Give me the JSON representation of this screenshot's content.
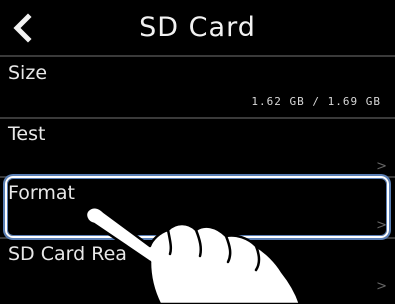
{
  "header": {
    "title": "SD Card",
    "back_icon": "chevron-left-icon"
  },
  "rows": [
    {
      "label": "Size",
      "value": "1.62 GB / 1.69 GB"
    },
    {
      "label": "Test",
      "chevron": ">"
    },
    {
      "label": "Format",
      "chevron": ">"
    },
    {
      "label": "SD Card Rea",
      "chevron": ">"
    }
  ],
  "colors": {
    "background": "#000000",
    "highlight_outline": "#5a7fb5"
  },
  "overlay": {
    "icon": "pointing-hand-icon"
  }
}
